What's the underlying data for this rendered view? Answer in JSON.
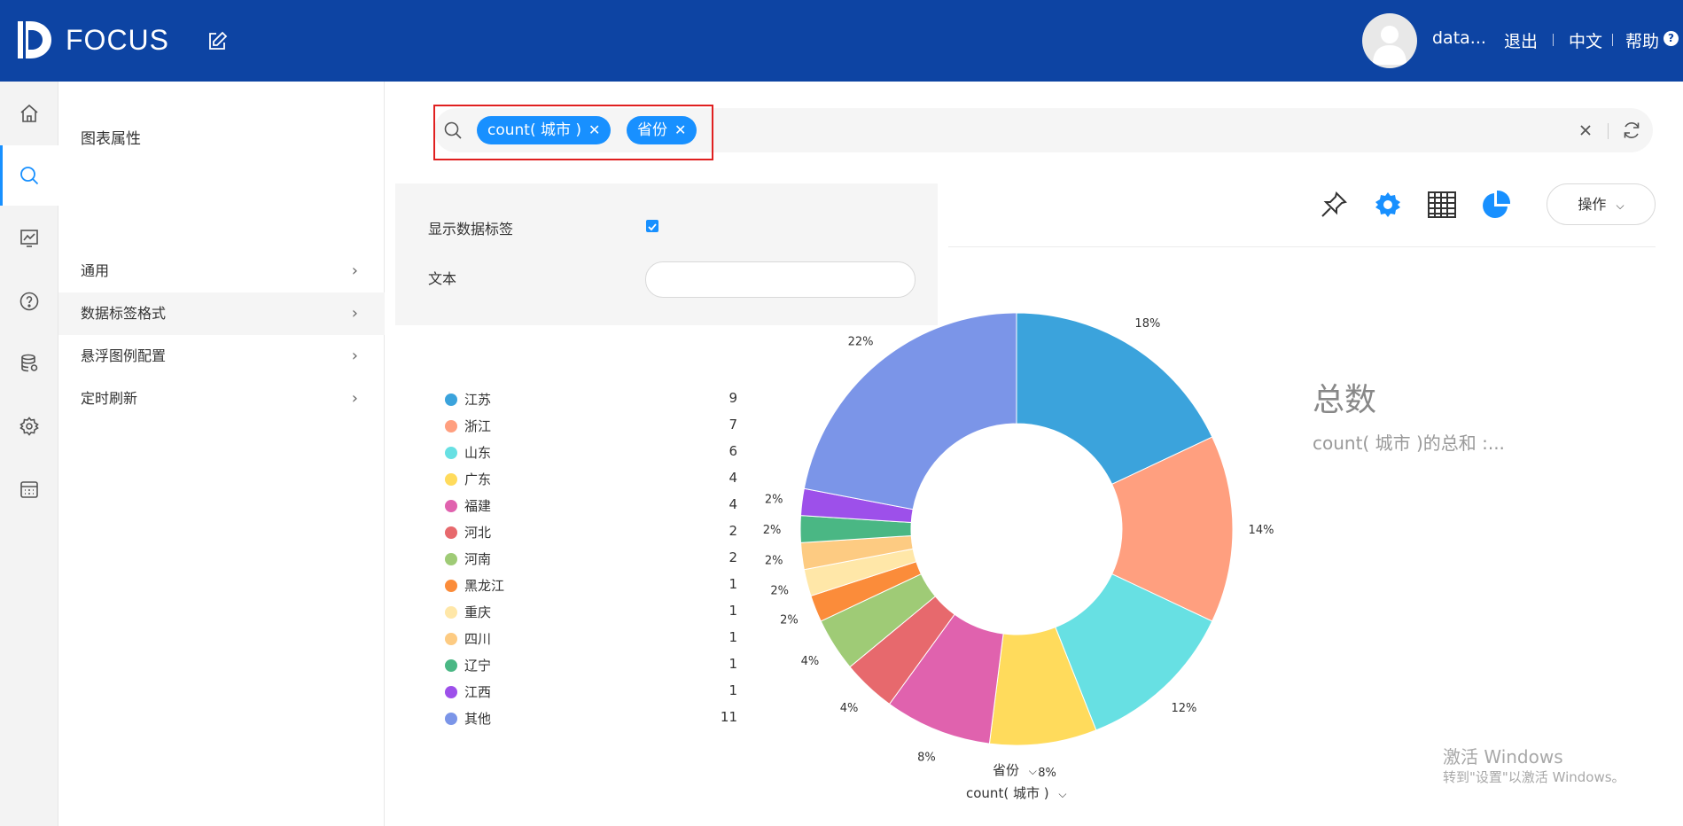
{
  "header": {
    "logo_text": "FOCUS",
    "user_name": "data...",
    "logout": "退出",
    "language": "中文",
    "help": "帮助",
    "help_badge": "?"
  },
  "nav": {
    "items": [
      "home-icon",
      "search-icon",
      "dashboard-icon",
      "question-icon",
      "database-icon",
      "gear-icon",
      "calendar-icon"
    ],
    "active": "search-icon"
  },
  "properties": {
    "title": "图表属性",
    "items": [
      {
        "label": "通用"
      },
      {
        "label": "数据标签格式"
      },
      {
        "label": "悬浮图例配置"
      },
      {
        "label": "定时刷新"
      }
    ],
    "active_index": 1
  },
  "search": {
    "chips": [
      {
        "label": "count(  城市  )"
      },
      {
        "label": "省份"
      }
    ]
  },
  "label_panel": {
    "show_labels": "显示数据标签",
    "show_labels_checked": true,
    "text_label": "文本",
    "text_value": ""
  },
  "toolbar": {
    "icons": [
      "pin-icon",
      "settings-icon",
      "table-icon",
      "pie-chart-icon"
    ],
    "operation": "操作"
  },
  "chart_data": {
    "type": "pie",
    "variant": "donut",
    "categories": [
      "江苏",
      "浙江",
      "山东",
      "广东",
      "福建",
      "河北",
      "河南",
      "黑龙江",
      "重庆",
      "四川",
      "辽宁",
      "江西",
      "其他"
    ],
    "values": [
      9,
      7,
      6,
      4,
      4,
      2,
      2,
      1,
      1,
      1,
      1,
      1,
      11
    ],
    "percent_labels": [
      "18%",
      "14%",
      "12%",
      "8%",
      "8%",
      "4%",
      "4%",
      "2%",
      "2%",
      "2%",
      "2%",
      "2%",
      "22%"
    ],
    "colors": [
      "#3ba3dc",
      "#ff9f7f",
      "#67e0e3",
      "#ffdb5c",
      "#e062ae",
      "#e7696d",
      "#9fcb76",
      "#fb8c3a",
      "#ffe7a8",
      "#fdcb82",
      "#4ab784",
      "#9d50ea",
      "#7b95e8"
    ],
    "legend": "left"
  },
  "axis_selectors": {
    "dimension": "省份",
    "measure": "count( 城市 )"
  },
  "summary": {
    "title": "总数",
    "subtitle": "count( 城市 )的总和 :..."
  },
  "watermark": {
    "line1": "激活 Windows",
    "line2": "转到\"设置\"以激活 Windows。"
  }
}
